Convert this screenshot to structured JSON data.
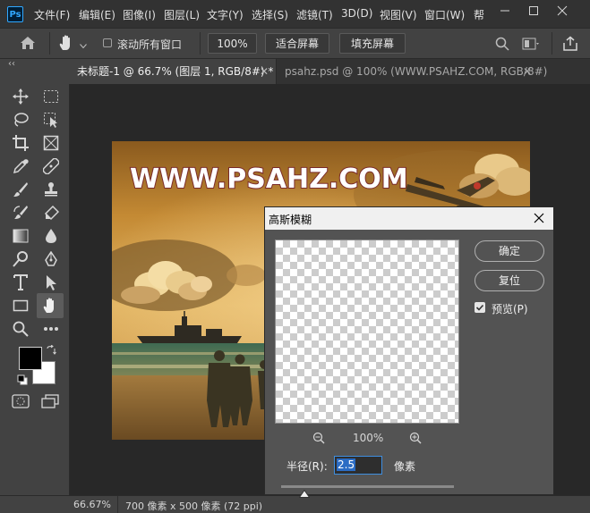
{
  "app": {
    "logo": "Ps",
    "menu": [
      "文件(F)",
      "编辑(E)",
      "图像(I)",
      "图层(L)",
      "文字(Y)",
      "选择(S)",
      "滤镜(T)",
      "3D(D)",
      "视图(V)",
      "窗口(W)",
      "帮"
    ]
  },
  "options_bar": {
    "scroll_all_windows": "滚动所有窗口",
    "zoom": "100%",
    "fit_screen": "适合屏幕",
    "fill_screen": "填充屏幕"
  },
  "tabs": [
    {
      "label": "未标题-1 @ 66.7% (图层 1, RGB/8#) *",
      "active": true
    },
    {
      "label": "psahz.psd @ 100% (WWW.PSAHZ.COM, RGB/8#)",
      "active": false
    }
  ],
  "toolbar": {
    "collapse": "‹‹"
  },
  "canvas": {
    "watermark": "WWW.PSAHZ.COM"
  },
  "status": {
    "zoom": "66.67%",
    "doc_info": "700 像素 x 500 像素 (72 ppi)"
  },
  "dialog": {
    "title": "高斯模糊",
    "ok": "确定",
    "reset": "复位",
    "preview_label": "预览(P)",
    "preview_checked": true,
    "zoom": "100%",
    "radius_label": "半径(R):",
    "radius_value": "2.5",
    "radius_unit": "像素"
  },
  "colors": {
    "accent": "#31a8ff",
    "panel": "#424242",
    "workspace": "#282828"
  }
}
